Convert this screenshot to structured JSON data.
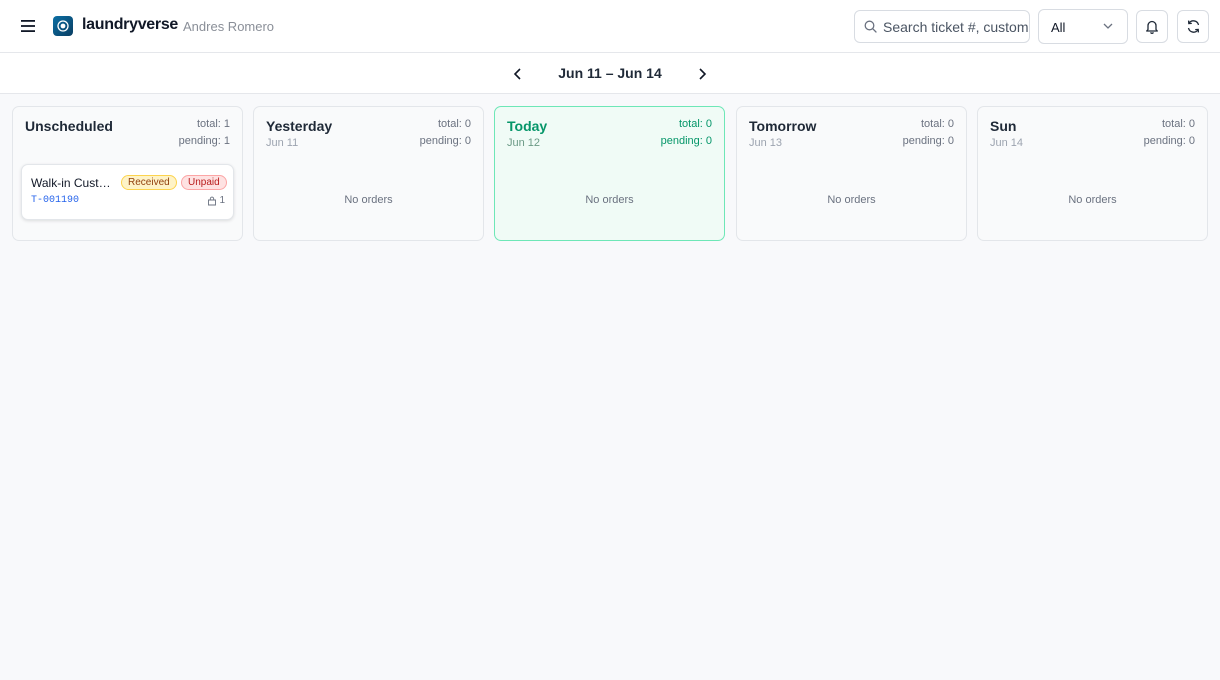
{
  "header": {
    "brand": "laundryverse",
    "user_name": "Andres Romero",
    "search_placeholder": "Search ticket #, customer",
    "filter_value": "All"
  },
  "date_nav": {
    "range_label": "Jun 11 – Jun 14"
  },
  "columns": [
    {
      "title": "Unscheduled",
      "date": "",
      "total": "total: 1",
      "pending": "pending: 1",
      "empty_label": "",
      "orders": [
        {
          "customer": "Walk-in Customer",
          "status": "Received",
          "payment": "Unpaid",
          "ticket": "T-001190",
          "bags": "1"
        }
      ]
    },
    {
      "title": "Yesterday",
      "date": "Jun 11",
      "total": "total: 0",
      "pending": "pending: 0",
      "empty_label": "No orders",
      "orders": []
    },
    {
      "title": "Today",
      "date": "Jun 12",
      "total": "total: 0",
      "pending": "pending: 0",
      "empty_label": "No orders",
      "orders": []
    },
    {
      "title": "Tomorrow",
      "date": "Jun 13",
      "total": "total: 0",
      "pending": "pending: 0",
      "empty_label": "No orders",
      "orders": []
    },
    {
      "title": "Sun",
      "date": "Jun 14",
      "total": "total: 0",
      "pending": "pending: 0",
      "empty_label": "No orders",
      "orders": []
    }
  ],
  "colors": {
    "today_accent": "#059669",
    "today_border": "#6ee7b7",
    "ticket_link": "#2563eb",
    "badge_received_bg": "#fef3c7",
    "badge_unpaid_bg": "#fee2e2"
  },
  "icons": {
    "menu": "hamburger-icon",
    "search": "search-icon",
    "dropdown": "chevron-down-icon",
    "notifications": "bell-icon",
    "refresh": "refresh-icon",
    "prev": "chevron-left-icon",
    "next": "chevron-right-icon",
    "bag": "bag-icon"
  }
}
